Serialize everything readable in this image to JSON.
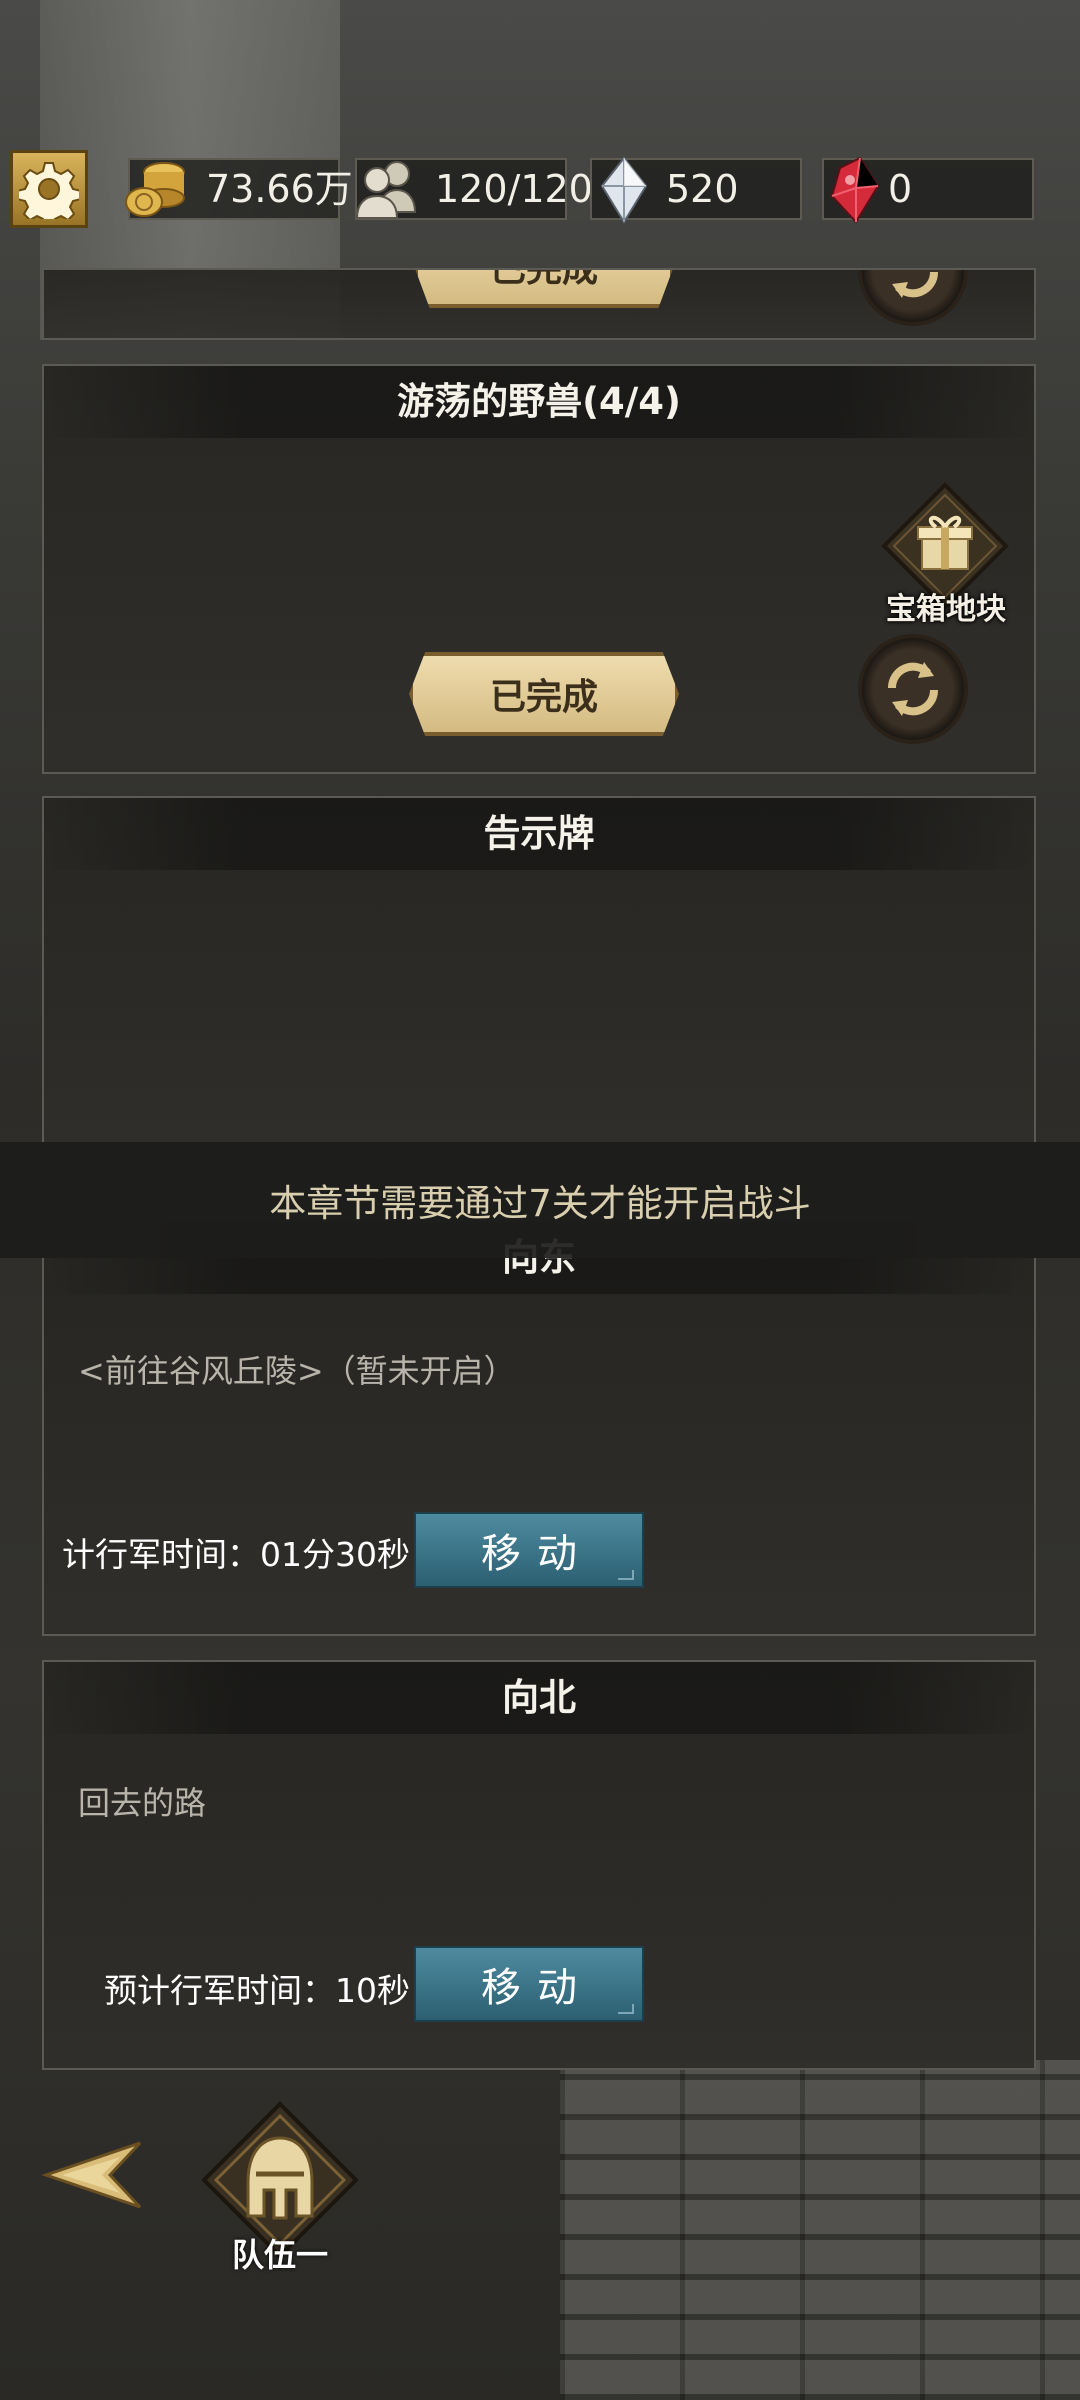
{
  "resources": {
    "gold": "73.66万",
    "troops": "120/120",
    "crystal": "520",
    "ruby": "0"
  },
  "panels": {
    "prev_done_label": "已完成",
    "beasts": {
      "title": "游荡的野兽(4/4)",
      "chest_label": "宝箱地块",
      "done_label": "已完成"
    },
    "notice": {
      "title": "告示牌"
    },
    "east": {
      "title": "向东",
      "desc": "<前往谷风丘陵>（暂未开启）",
      "march_time": "计行军时间：01分30秒",
      "move_label": "移动"
    },
    "north": {
      "title": "向北",
      "desc": "回去的路",
      "march_time": "预计行军时间：10秒",
      "move_label": "移动"
    }
  },
  "toast": "本章节需要通过7关才能开启战斗",
  "bottom": {
    "team_label": "队伍一"
  },
  "colors": {
    "gold_accent": "#d4bb82",
    "move_button": "#3d7689",
    "toast_text": "#d9cfae"
  }
}
